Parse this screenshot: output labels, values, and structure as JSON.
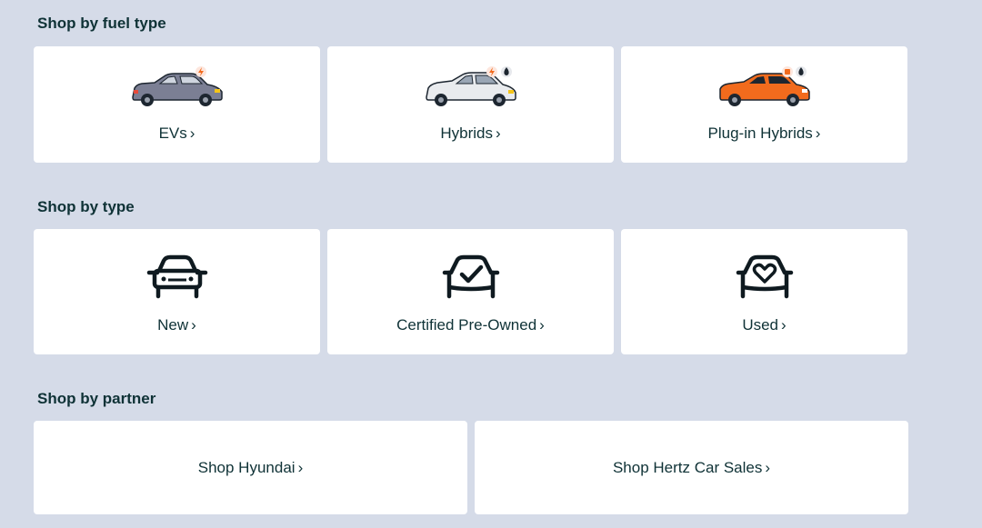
{
  "sections": [
    {
      "title": "Shop by fuel type",
      "cards": [
        {
          "label": "EVs",
          "icon": "ev-car-icon",
          "chevron": "›"
        },
        {
          "label": "Hybrids",
          "icon": "hybrid-car-icon",
          "chevron": "›"
        },
        {
          "label": "Plug-in Hybrids",
          "icon": "plugin-hybrid-car-icon",
          "chevron": "›"
        }
      ]
    },
    {
      "title": "Shop by type",
      "cards": [
        {
          "label": "New",
          "icon": "new-car-icon",
          "chevron": "›"
        },
        {
          "label": "Certified Pre-Owned",
          "icon": "certified-car-icon",
          "chevron": "›"
        },
        {
          "label": "Used",
          "icon": "used-car-heart-icon",
          "chevron": "›"
        }
      ]
    },
    {
      "title": "Shop by partner",
      "cards": [
        {
          "label": "Shop Hyundai",
          "chevron": "›"
        },
        {
          "label": "Shop Hertz Car Sales",
          "chevron": "›"
        }
      ]
    }
  ],
  "colors": {
    "background": "#d5dbe8",
    "card": "#ffffff",
    "text": "#0f3236",
    "ev_car": "#7b7f94",
    "hybrid_car": "#e9ebee",
    "plugin_car": "#f26b1d",
    "accent_orange": "#f26b1d"
  }
}
